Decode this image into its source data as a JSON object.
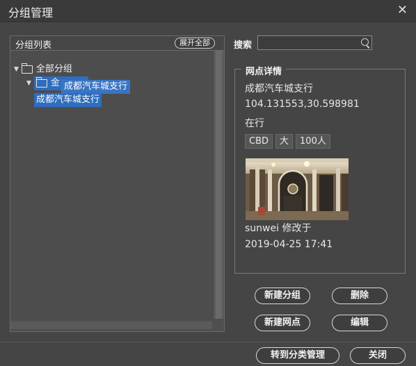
{
  "window": {
    "title": "分组管理",
    "close_icon": "close-icon"
  },
  "group_list": {
    "header": "分组列表",
    "expand_all": "展开全部",
    "tree": [
      {
        "label": "全部分组",
        "expanded": true
      },
      {
        "label": "金",
        "expanded": true,
        "selected": true
      },
      {
        "label": "成都汽车城支行",
        "selected": true
      }
    ],
    "drag_ghost": "成都汽车城支行"
  },
  "search": {
    "label": "搜索",
    "value": "",
    "placeholder": ""
  },
  "detail": {
    "legend": "网点详情",
    "name": "成都汽车城支行",
    "coords": "104.131553,30.598981",
    "status": "在行",
    "tags": [
      "CBD",
      "大",
      "100人"
    ],
    "modified_by": "sunwei 修改于",
    "modified_at": "2019-04-25 17:41"
  },
  "actions": {
    "new_group": "新建分组",
    "delete": "删除",
    "new_site": "新建网点",
    "edit": "编辑"
  },
  "footer": {
    "goto_category": "转到分类管理",
    "close": "关闭"
  }
}
